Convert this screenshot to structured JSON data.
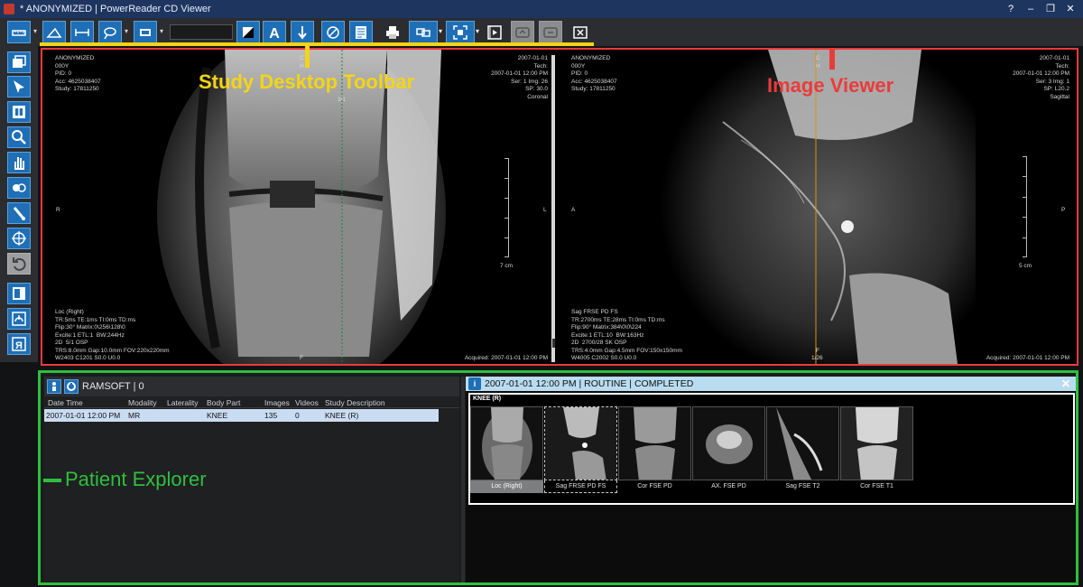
{
  "window": {
    "title": "* ANONYMIZED | PowerReader CD Viewer",
    "controls": [
      "?",
      "–",
      "❐",
      "✕"
    ]
  },
  "annotations": {
    "toolbar": "Study Desktop Toolbar",
    "viewer": "Image Viewer",
    "explorer": "Patient Explorer"
  },
  "viewport1": {
    "top_left": "ANONYMIZED\n000Y\nPID: 0\nAcc: 4625038407\nStudy: 17811250",
    "top_center": "C\nH",
    "top_right": "2007-01-01\nTech:\n2007-01-01 12:00 PM\nSer: 1 Img: 26\nSP: 30.0\nCoronal",
    "frame": "3/1",
    "left_orient": "R",
    "right_orient": "L",
    "bottom_orient": "F",
    "scale": "7 cm",
    "bottom_left": "Loc (Right)\nTR:5ms TE:1ms TI:0ms TD:ms\nFlip:30° Matrix:0\\256\\128\\0\nExcite:1 ETL:1  BW:244Hz\n2D  5/1 OSP\nTRS:8.0mm Gap:10.0mm FOV:220x220mm\nW2403 C1201 S0.0 U0.0",
    "bottom_right": "Acquired: 2007-01-01 12:00 PM"
  },
  "viewport2": {
    "top_left": "ANONYMIZED\n000Y\nPID: 0\nAcc: 4625038407\nStudy: 17811250",
    "top_center": "C\nH",
    "top_right": "2007-01-01\nTech:\n2007-01-01 12:00 PM\nSer: 3 Img: 1\nSP: L20.2\nSagittal",
    "left_orient": "A",
    "right_orient": "P",
    "bottom_orient": "F",
    "scale": "5 cm",
    "frame_bottom": "1/26",
    "bottom_left": "Sag FRSE PD FS\nTR:2700ms TE:28ms TI:0ms TD:ms\nFlip:90° Matrix:384\\0\\0\\224\nExcite:1 ETL:10  BW:163Hz\n2D  2700/28 SK OSP\nTRS:4.0mm Gap:4.5mm FOV:150x150mm\nW4005 C2002 S0.0 U0.0",
    "bottom_right": "Acquired: 2007-01-01 12:00 PM"
  },
  "patient": {
    "name": "RAMSOFT | 0",
    "columns": [
      "Date Time",
      "Modality",
      "Laterality",
      "Body Part",
      "Images",
      "Videos",
      "Study Description"
    ],
    "rows": [
      {
        "datetime": "2007-01-01 12:00 PM",
        "modality": "MR",
        "laterality": "",
        "bodypart": "KNEE",
        "images": "135",
        "videos": "0",
        "description": "KNEE (R)"
      }
    ]
  },
  "study": {
    "header": "2007-01-01 12:00 PM | ROUTINE | COMPLETED",
    "panel_label": "KNEE (R)",
    "series": [
      {
        "label": "Loc (Right)",
        "state": "selected"
      },
      {
        "label": "Sag FRSE PD FS",
        "state": "active"
      },
      {
        "label": "Cor FSE PD",
        "state": ""
      },
      {
        "label": "AX. FSE PD",
        "state": ""
      },
      {
        "label": "Sag FSE T2",
        "state": ""
      },
      {
        "label": "Cor FSE T1",
        "state": ""
      }
    ]
  },
  "colors": {
    "accent": "#1f6fb6",
    "title_bar": "#1e3560",
    "toolbar_annotation": "#f5d415",
    "viewer_annotation": "#ea3b3b",
    "explorer_annotation": "#2fbf3f"
  }
}
